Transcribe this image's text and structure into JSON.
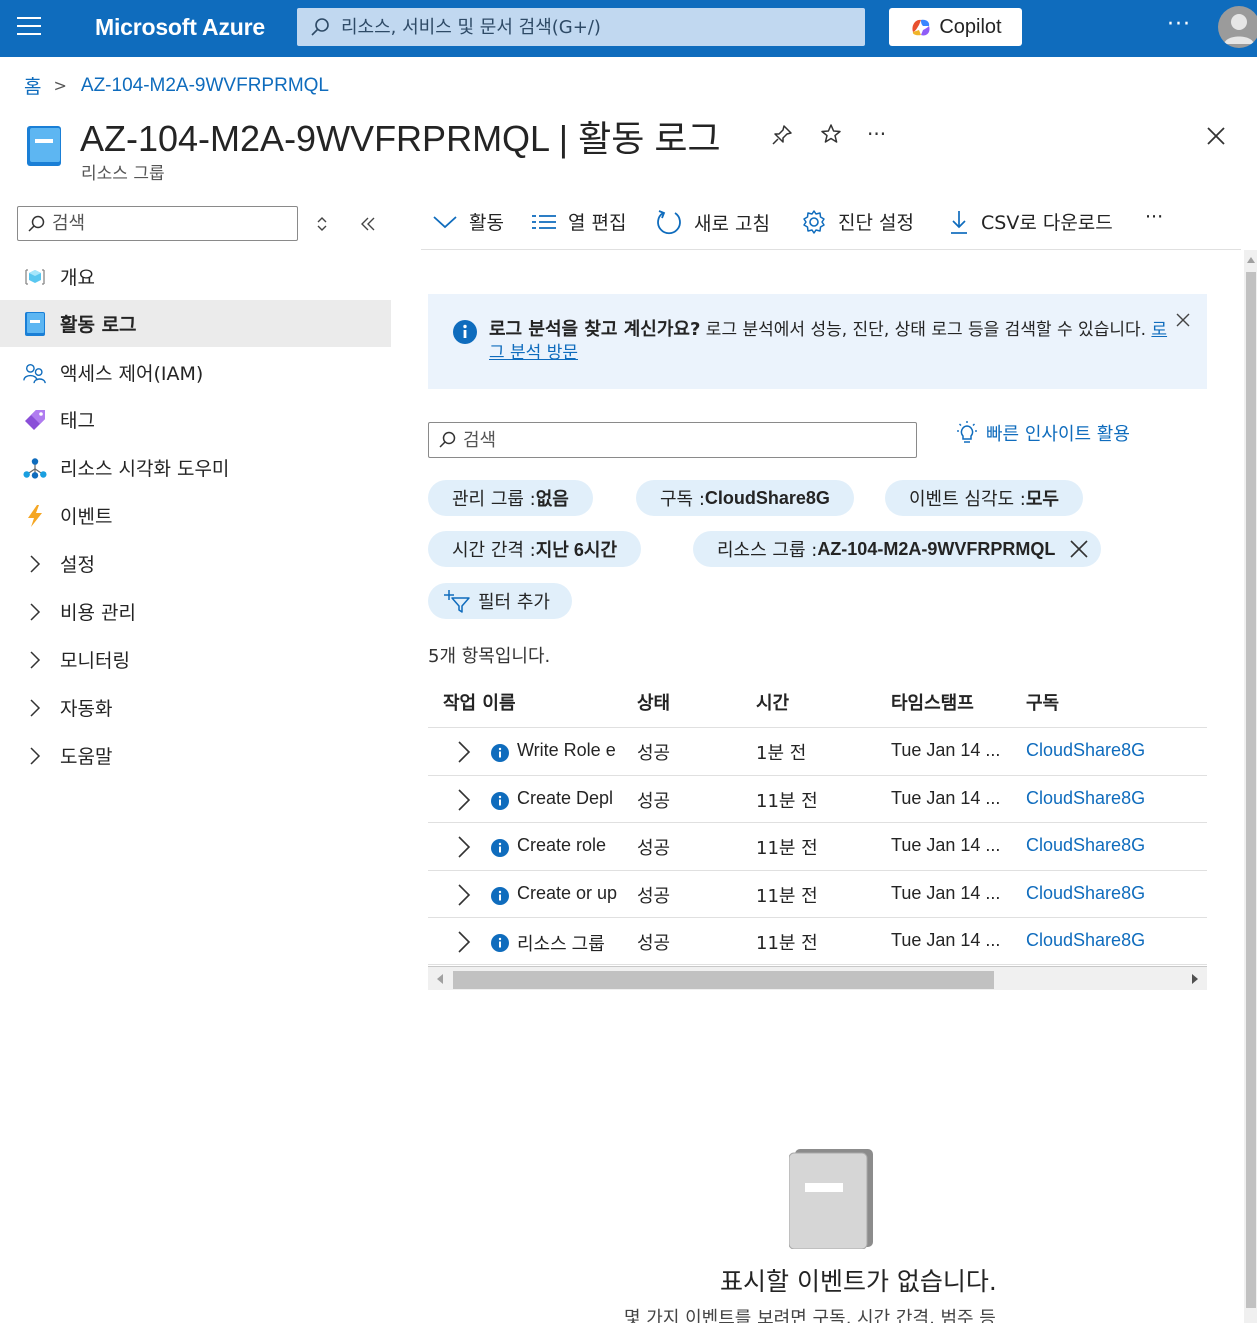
{
  "topbar": {
    "brand": "Microsoft Azure",
    "search_placeholder": "리소스, 서비스 및 문서 검색(G+/)",
    "copilot_label": "Copilot",
    "more": "···"
  },
  "breadcrumb": {
    "home": "홈",
    "current": "AZ-104-M2A-9WVFRPRMQL"
  },
  "header": {
    "title": "AZ-104-M2A-9WVFRPRMQL | 활동 로그",
    "subtitle": "리소스 그룹",
    "more": "···"
  },
  "sidebar": {
    "search_placeholder": "검색",
    "items": [
      {
        "label": "개요",
        "icon": "cube-icon",
        "expandable": false
      },
      {
        "label": "활동 로그",
        "icon": "activity-log-icon",
        "expandable": false,
        "active": true
      },
      {
        "label": "액세스 제어(IAM)",
        "icon": "people-icon",
        "expandable": false
      },
      {
        "label": "태그",
        "icon": "tag-icon",
        "expandable": false
      },
      {
        "label": "리소스 시각화 도우미",
        "icon": "visualizer-icon",
        "expandable": false
      },
      {
        "label": "이벤트",
        "icon": "lightning-icon",
        "expandable": false
      },
      {
        "label": "설정",
        "icon": "chevron-right-icon",
        "expandable": true
      },
      {
        "label": "비용 관리",
        "icon": "chevron-right-icon",
        "expandable": true
      },
      {
        "label": "모니터링",
        "icon": "chevron-right-icon",
        "expandable": true
      },
      {
        "label": "자동화",
        "icon": "chevron-right-icon",
        "expandable": true
      },
      {
        "label": "도움말",
        "icon": "chevron-right-icon",
        "expandable": true
      }
    ]
  },
  "toolbar": {
    "activity": "활동",
    "edit_columns": "열 편집",
    "refresh": "새로 고침",
    "diagnostic": "진단 설정",
    "download_csv": "CSV로 다운로드",
    "more": "···"
  },
  "banner": {
    "bold": "로그 분석을 찾고 계신가요?",
    "text": " 로그 분석에서 성능, 진단, 상태 로그 등을 검색할 수 있습니다. ",
    "link": "로그 분석 방문"
  },
  "search": {
    "placeholder": "검색",
    "insights": "빠른 인사이트 활용"
  },
  "filters": {
    "mgmt_group_label": "관리 그룹 : ",
    "mgmt_group_value": "없음",
    "subscription_label": "구독 : ",
    "subscription_value": "CloudShare8G",
    "severity_label": "이벤트 심각도 : ",
    "severity_value": "모두",
    "timespan_label": "시간 간격 : ",
    "timespan_value": "지난 6시간",
    "resource_group_label": "리소스 그룹 : ",
    "resource_group_value": "AZ-104-M2A-9WVFRPRMQL",
    "add_filter": "필터 추가"
  },
  "table": {
    "count_text": "5개 항목입니다.",
    "columns": [
      "작업 이름",
      "상태",
      "시간",
      "타임스탬프",
      "구독"
    ],
    "rows": [
      {
        "name": "Write Role e",
        "status": "성공",
        "time": "1분 전",
        "timestamp": "Tue Jan 14 ...",
        "subscription": "CloudShare8G"
      },
      {
        "name": "Create Depl",
        "status": "성공",
        "time": "11분 전",
        "timestamp": "Tue Jan 14 ...",
        "subscription": "CloudShare8G"
      },
      {
        "name": "Create role",
        "status": "성공",
        "time": "11분 전",
        "timestamp": "Tue Jan 14 ...",
        "subscription": "CloudShare8G"
      },
      {
        "name": "Create or up",
        "status": "성공",
        "time": "11분 전",
        "timestamp": "Tue Jan 14 ...",
        "subscription": "CloudShare8G"
      },
      {
        "name": "리소스 그룹",
        "status": "성공",
        "time": "11분 전",
        "timestamp": "Tue Jan 14 ...",
        "subscription": "CloudShare8G"
      }
    ]
  },
  "empty": {
    "title": "표시할 이벤트가 없습니다.",
    "desc": "몇 가지 이벤트를 보려면 구독, 시간 간격, 범주 등"
  },
  "colors": {
    "brand_blue": "#0f6cbd",
    "banner_bg": "#ebf3fc",
    "pill_bg": "#e1effa",
    "active_nav_bg": "#ebebeb"
  }
}
